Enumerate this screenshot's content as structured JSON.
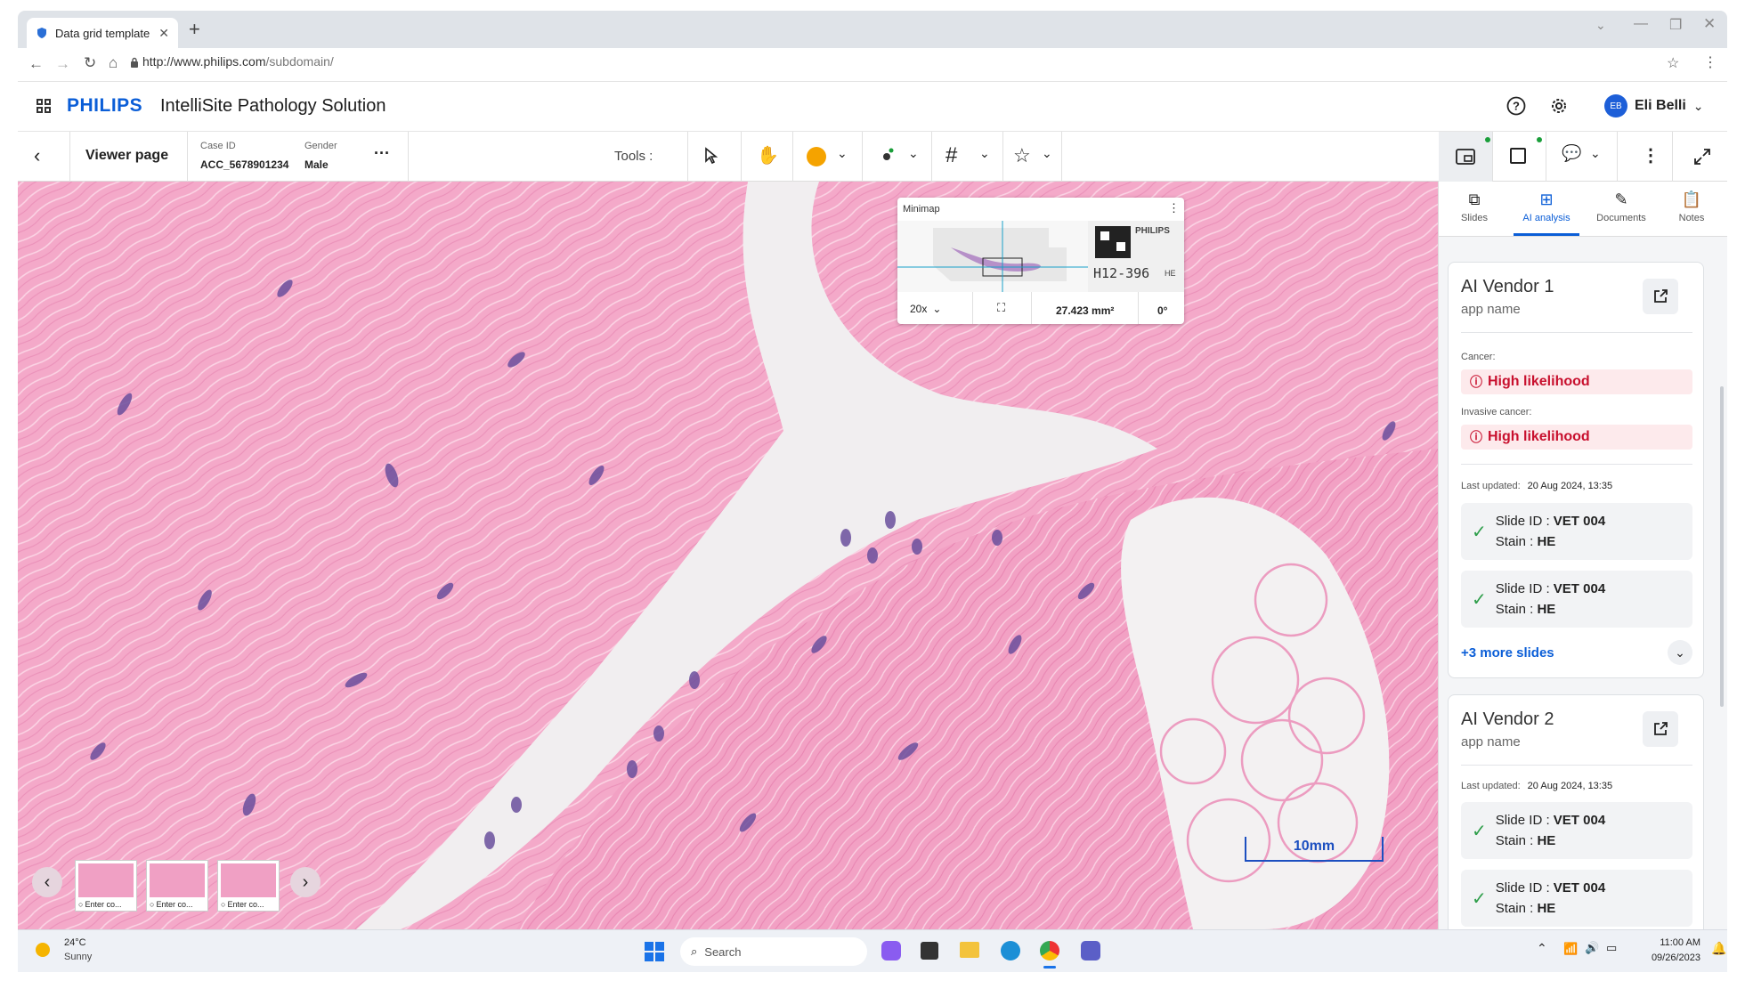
{
  "browser": {
    "tab_title": "Data grid template",
    "url_main": "http://www.philips.com",
    "url_path": "/subdomain/"
  },
  "header": {
    "brand": "PHILIPS",
    "product": "IntelliSite Pathology Solution",
    "user_initials": "EB",
    "user_name": "Eli Belli"
  },
  "toolbar": {
    "page_title": "Viewer page",
    "case_id_label": "Case ID",
    "case_id_value": "ACC_5678901234",
    "gender_label": "Gender",
    "gender_value": "Male",
    "tools_label": "Tools :",
    "accent_color": "#f5a300"
  },
  "minimap": {
    "title": "Minimap",
    "zoom": "20x",
    "area": "27.423 mm²",
    "rotation": "0°",
    "label_brand": "PHILIPS",
    "label_id": "H12-396",
    "label_stain": "HE"
  },
  "scale_bar": "10mm",
  "thumbnails": [
    {
      "label": "Enter co..."
    },
    {
      "label": "Enter co..."
    },
    {
      "label": "Enter co..."
    }
  ],
  "panel_tabs": [
    {
      "label": "Slides",
      "icon": "slides-icon"
    },
    {
      "label": "AI analysis",
      "icon": "chip-icon",
      "active": true
    },
    {
      "label": "Documents",
      "icon": "paperclip-icon"
    },
    {
      "label": "Notes",
      "icon": "clipboard-icon"
    }
  ],
  "vendors": [
    {
      "name": "AI Vendor 1",
      "app": "app name",
      "cancer_label": "Cancer:",
      "cancer_value": "High likelihood",
      "invasive_label": "Invasive cancer:",
      "invasive_value": "High likelihood",
      "updated_label": "Last updated:",
      "updated_value": "20 Aug 2024, 13:35",
      "slides": [
        {
          "id_label": "Slide ID :",
          "id": "VET 004",
          "stain_label": "Stain :",
          "stain": "HE"
        },
        {
          "id_label": "Slide ID :",
          "id": "VET 004",
          "stain_label": "Stain :",
          "stain": "HE"
        }
      ],
      "more": "+3 more slides"
    },
    {
      "name": "AI Vendor 2",
      "app": "app name",
      "updated_label": "Last updated:",
      "updated_value": "20 Aug 2024, 13:35",
      "slides": [
        {
          "id_label": "Slide ID :",
          "id": "VET 004",
          "stain_label": "Stain :",
          "stain": "HE"
        },
        {
          "id_label": "Slide ID :",
          "id": "VET 004",
          "stain_label": "Stain :",
          "stain": "HE"
        }
      ]
    }
  ],
  "taskbar": {
    "temp": "24°C",
    "weather": "Sunny",
    "search": "Search",
    "time": "11:00 AM",
    "date": "09/26/2023"
  },
  "colors": {
    "primary": "#0b5ed7",
    "danger": "#c8102e",
    "success": "#2e9e4a",
    "tissue": "#f2a5c7"
  }
}
